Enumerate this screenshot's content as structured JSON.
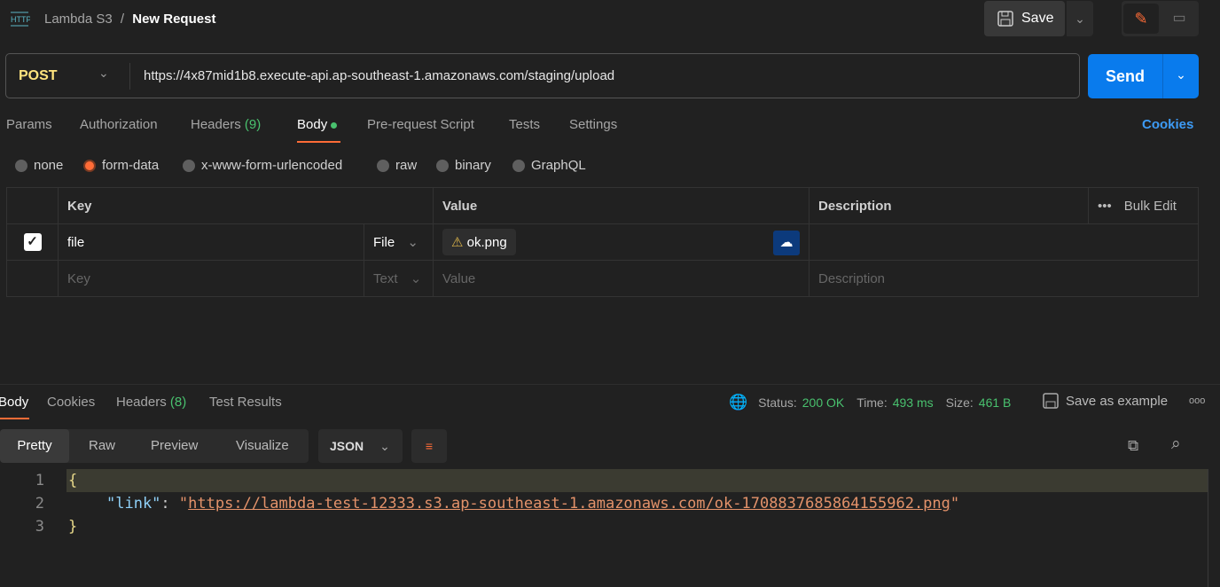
{
  "header": {
    "icon": "http-icon",
    "collection": "Lambda S3",
    "separator": "/",
    "request_name": "New Request",
    "save_label": "Save"
  },
  "request": {
    "method": "POST",
    "url": "https://4x87mid1b8.execute-api.ap-southeast-1.amazonaws.com/staging/upload",
    "send_label": "Send"
  },
  "tabs": {
    "params": "Params",
    "authorization": "Authorization",
    "headers": "Headers",
    "headers_count": "(9)",
    "body": "Body",
    "prerequest": "Pre-request Script",
    "tests": "Tests",
    "settings": "Settings",
    "cookies": "Cookies"
  },
  "body_types": [
    "none",
    "form-data",
    "x-www-form-urlencoded",
    "raw",
    "binary",
    "GraphQL"
  ],
  "body_type_selected": "form-data",
  "table": {
    "headers": {
      "key": "Key",
      "value": "Value",
      "description": "Description",
      "bulk_edit": "Bulk Edit"
    },
    "rows": [
      {
        "checked": true,
        "key": "file",
        "type": "File",
        "value": "ok.png",
        "description": ""
      }
    ],
    "placeholder": {
      "key": "Key",
      "type": "Text",
      "value": "Value",
      "description": "Description"
    }
  },
  "response": {
    "tabs": {
      "body": "Body",
      "cookies": "Cookies",
      "headers": "Headers",
      "headers_count": "(8)",
      "test_results": "Test Results"
    },
    "status_label": "Status:",
    "status": "200 OK",
    "time_label": "Time:",
    "time": "493 ms",
    "size_label": "Size:",
    "size": "461 B",
    "save_example": "Save as example",
    "views": {
      "pretty": "Pretty",
      "raw": "Raw",
      "preview": "Preview",
      "visualize": "Visualize"
    },
    "format": "JSON",
    "code": {
      "l1": "{",
      "key": "\"link\"",
      "colon": ": ",
      "q": "\"",
      "link": "https://lambda-test-12333.s3.ap-southeast-1.amazonaws.com/ok-1708837685864155962.png",
      "l3": "}"
    }
  },
  "colors": {
    "accent": "#ff6c37",
    "send": "#097bed",
    "green": "#49c16e",
    "method": "#ffe47e"
  }
}
